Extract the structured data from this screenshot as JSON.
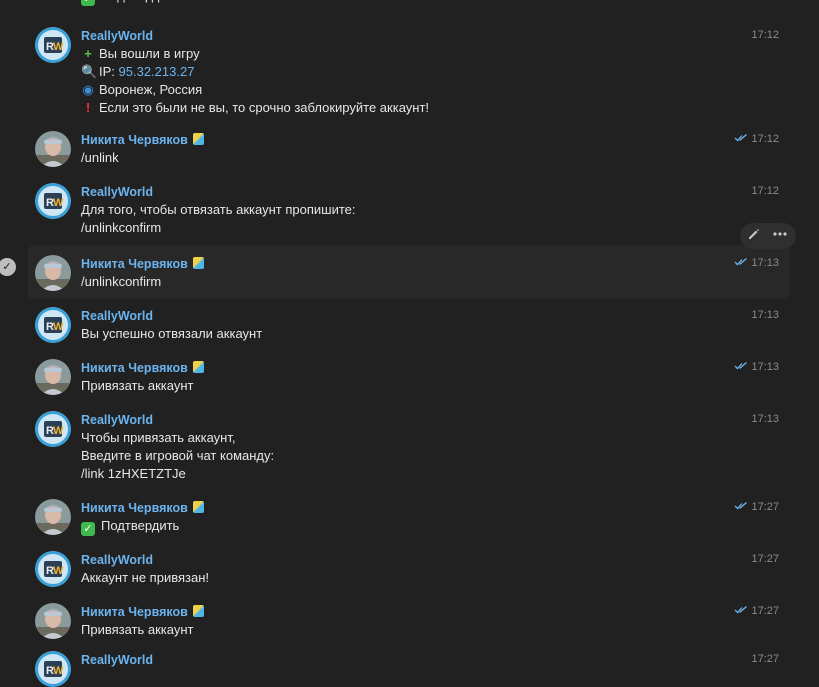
{
  "messages": [
    {
      "sender": "",
      "lines": [
        {
          "emoji": "ok",
          "text": "Подтвердить"
        }
      ],
      "time": "",
      "own": false,
      "partial": "top"
    },
    {
      "sender": "ReallyWorld",
      "time": "17:12",
      "own": false,
      "lines": [
        {
          "emoji": "plus",
          "text": "Вы вошли в игру"
        },
        {
          "emoji": "magnifier",
          "text": "IP: ",
          "link": "95.32.213.27"
        },
        {
          "emoji": "globe",
          "text": "Воронеж, Россия"
        },
        {
          "emoji": "exclamation",
          "text": "Если это были не вы, то срочно заблокируйте аккаунт!"
        }
      ]
    },
    {
      "sender": "Никита Червяков",
      "time": "17:12",
      "own": true,
      "lines": [
        {
          "text": "/unlink"
        }
      ]
    },
    {
      "sender": "ReallyWorld",
      "time": "17:12",
      "own": false,
      "lines": [
        {
          "text": "Для того, чтобы отвязать аккаунт пропишите:"
        },
        {
          "text": "/unlinkconfirm"
        }
      ]
    },
    {
      "sender": "Никита Червяков",
      "time": "17:13",
      "own": true,
      "selected": true,
      "lines": [
        {
          "text": "/unlinkconfirm"
        }
      ]
    },
    {
      "sender": "ReallyWorld",
      "time": "17:13",
      "own": false,
      "lines": [
        {
          "text": "Вы успешно отвязали аккаунт"
        }
      ]
    },
    {
      "sender": "Никита Червяков",
      "time": "17:13",
      "own": true,
      "lines": [
        {
          "text": "Привязать аккаунт"
        }
      ]
    },
    {
      "sender": "ReallyWorld",
      "time": "17:13",
      "own": false,
      "lines": [
        {
          "text": "Чтобы привязать аккаунт,"
        },
        {
          "text": "Введите в игровой чат команду:"
        },
        {
          "text": "/link 1zHXETZTJe"
        }
      ]
    },
    {
      "sender": "Никита Червяков",
      "time": "17:27",
      "own": true,
      "lines": [
        {
          "emoji": "ok",
          "text": "Подтвердить"
        }
      ]
    },
    {
      "sender": "ReallyWorld",
      "time": "17:27",
      "own": false,
      "lines": [
        {
          "text": "Аккаунт не привязан!"
        }
      ]
    },
    {
      "sender": "Никита Червяков",
      "time": "17:27",
      "own": true,
      "lines": [
        {
          "text": "Привязать аккаунт"
        }
      ]
    },
    {
      "sender": "ReallyWorld",
      "time": "17:27",
      "own": false,
      "lines": [],
      "partial": "bottom"
    }
  ],
  "icons": {
    "edit": "pencil-icon",
    "more": "more-horizontal-icon",
    "read": "double-check-icon",
    "selected": "checkmark-circle-icon"
  },
  "colors": {
    "background": "#212121",
    "accent": "#6cb4ee",
    "text": "#e7e7e7",
    "time": "#8a8a8a",
    "highlight": "#282828"
  }
}
